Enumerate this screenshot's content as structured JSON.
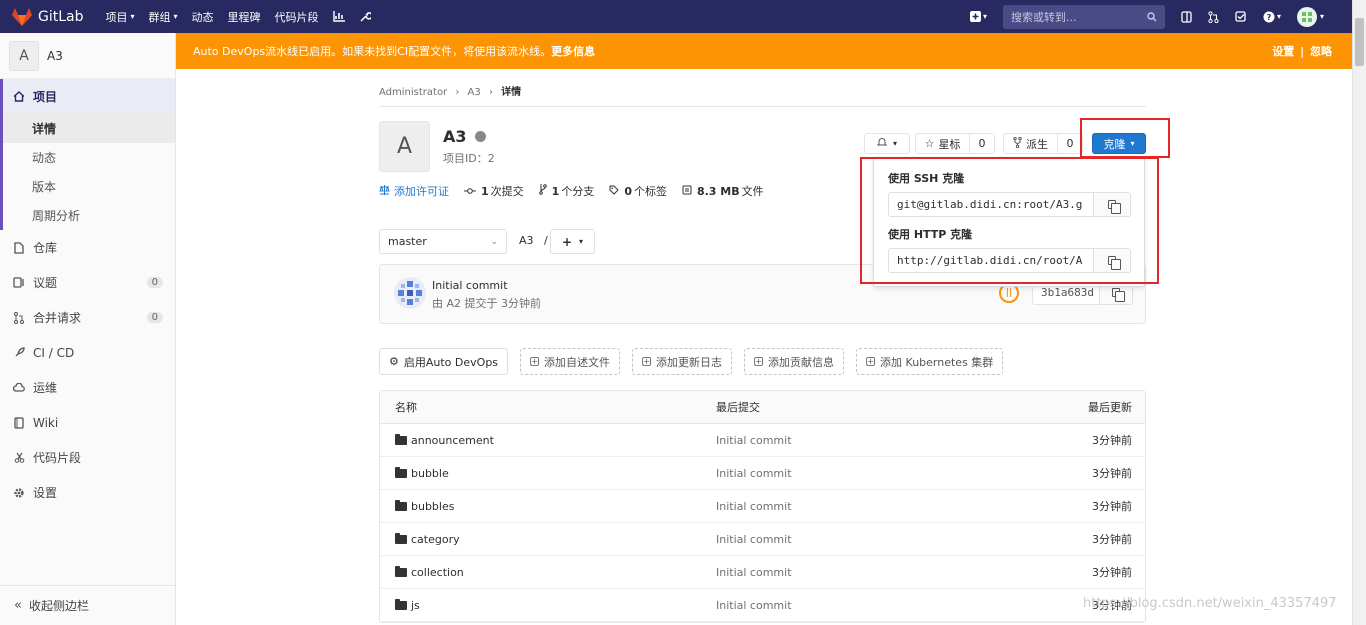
{
  "navbar": {
    "brand": "GitLab",
    "items": [
      {
        "label": "项目",
        "dropdown": true
      },
      {
        "label": "群组",
        "dropdown": true
      },
      {
        "label": "动态",
        "dropdown": false
      },
      {
        "label": "里程碑",
        "dropdown": false
      },
      {
        "label": "代码片段",
        "dropdown": false
      }
    ],
    "search_placeholder": "搜索或转到..."
  },
  "sidebar": {
    "project_initial": "A",
    "project_name": "A3",
    "active_section": "项目",
    "sub_items": [
      "详情",
      "动态",
      "版本",
      "周期分析"
    ],
    "items": [
      {
        "label": "仓库",
        "icon": "doc-icon"
      },
      {
        "label": "议题",
        "icon": "issues-icon",
        "count": "0"
      },
      {
        "label": "合并请求",
        "icon": "merge-icon",
        "count": "0"
      },
      {
        "label": "CI / CD",
        "icon": "rocket-icon"
      },
      {
        "label": "运维",
        "icon": "cloud-icon"
      },
      {
        "label": "Wiki",
        "icon": "book-icon"
      },
      {
        "label": "代码片段",
        "icon": "scissors-icon"
      },
      {
        "label": "设置",
        "icon": "gear-icon"
      }
    ],
    "collapse_label": "收起侧边栏"
  },
  "banner": {
    "text": "Auto DevOps流水线已启用。如果未找到CI配置文件，将使用该流水线。",
    "link": "更多信息",
    "right_settings": "设置",
    "right_sep": "|",
    "right_dismiss": "忽略"
  },
  "breadcrumb": {
    "root": "Administrator",
    "project": "A3",
    "current": "详情"
  },
  "project": {
    "initial": "A",
    "title": "A3",
    "id_label": "项目ID：",
    "id_value": "2",
    "star_label": "星标",
    "star_count": "0",
    "fork_label": "派生",
    "fork_count": "0",
    "clone_label": "克隆"
  },
  "stats": {
    "license": "添加许可证",
    "commits_num": "1",
    "commits_label": "次提交",
    "branches_num": "1",
    "branches_label": "个分支",
    "tags_num": "0",
    "tags_label": "个标签",
    "size_num": "8.3 MB",
    "size_label": "文件"
  },
  "repo": {
    "branch": "master",
    "path": "A3",
    "path_sep": "/",
    "plus": "+"
  },
  "commit": {
    "title": "Initial commit",
    "subtitle": "由 A2 提交于 3分钟前",
    "sha": "3b1a683d"
  },
  "actions": {
    "auto_devops": "启用Auto DevOps",
    "readme": "添加自述文件",
    "changelog": "添加更新日志",
    "contributing": "添加贡献信息",
    "k8s": "添加 Kubernetes 集群"
  },
  "tree": {
    "headers": {
      "name": "名称",
      "commit": "最后提交",
      "updated": "最后更新"
    },
    "rows": [
      {
        "name": "announcement",
        "commit": "Initial commit",
        "time": "3分钟前"
      },
      {
        "name": "bubble",
        "commit": "Initial commit",
        "time": "3分钟前"
      },
      {
        "name": "bubbles",
        "commit": "Initial commit",
        "time": "3分钟前"
      },
      {
        "name": "category",
        "commit": "Initial commit",
        "time": "3分钟前"
      },
      {
        "name": "collection",
        "commit": "Initial commit",
        "time": "3分钟前"
      },
      {
        "name": "js",
        "commit": "Initial commit",
        "time": "3分钟前"
      }
    ]
  },
  "clone_dropdown": {
    "ssh_label": "使用 SSH 克隆",
    "ssh_url": "git@gitlab.didi.cn:root/A3.g",
    "http_label": "使用 HTTP 克隆",
    "http_url": "http://gitlab.didi.cn/root/A"
  },
  "watermark": "https://blog.csdn.net/weixin_43357497",
  "colors": {
    "navbar": "#292961",
    "banner": "#fc9403",
    "primary": "#1f78d1",
    "highlight": "#e4262a"
  }
}
